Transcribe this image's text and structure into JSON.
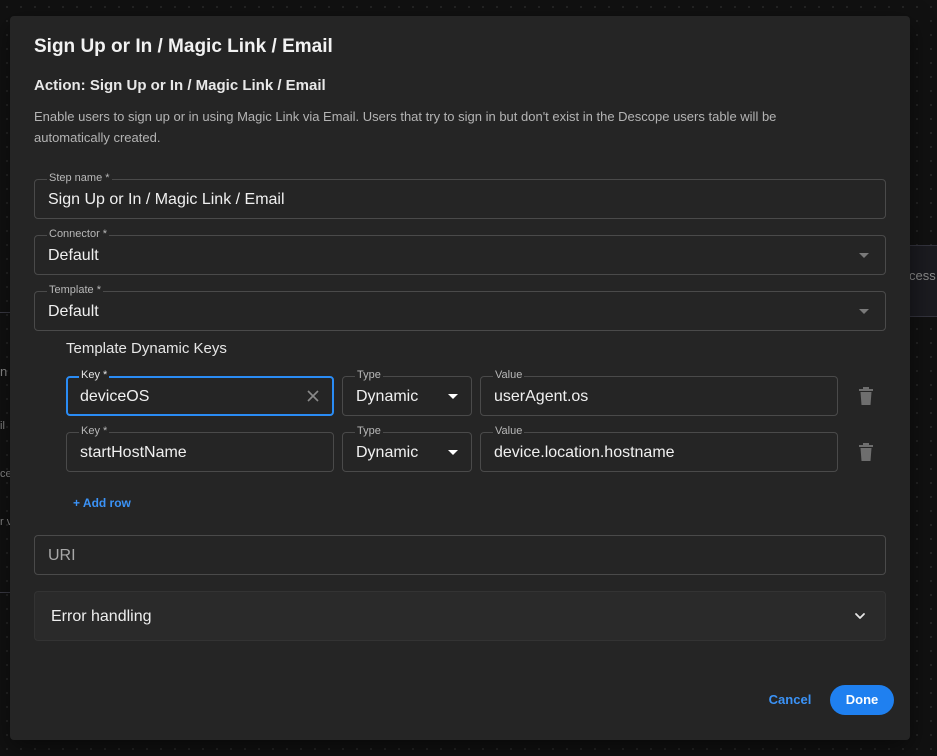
{
  "background": {
    "fragments": [
      "cess",
      "n l",
      "il",
      "ce",
      "r v"
    ]
  },
  "modal": {
    "title": "Sign Up or In / Magic Link / Email",
    "action_title": "Action: Sign Up or In / Magic Link / Email",
    "description": "Enable users to sign up or in using Magic Link via Email. Users that try to sign in but don't exist in the Descope users table will be automatically created."
  },
  "step_name": {
    "label": "Step name *",
    "value": "Sign Up or In / Magic Link / Email"
  },
  "connector": {
    "label": "Connector *",
    "value": "Default"
  },
  "template": {
    "label": "Template *",
    "value": "Default"
  },
  "dynamic_keys": {
    "title": "Template Dynamic Keys",
    "rows": [
      {
        "key_label": "Key *",
        "key": "deviceOS",
        "type_label": "Type",
        "type": "Dynamic",
        "value_label": "Value",
        "value": "userAgent.os"
      },
      {
        "key_label": "Key *",
        "key": "startHostName",
        "type_label": "Type",
        "type": "Dynamic",
        "value_label": "Value",
        "value": "device.location.hostname"
      }
    ],
    "add_row": "+ Add row"
  },
  "uri": {
    "placeholder": "URI"
  },
  "error_handling": {
    "label": "Error handling"
  },
  "actions": {
    "cancel": "Cancel",
    "done": "Done"
  },
  "colors": {
    "accent": "#2a8cf5",
    "modal_bg": "#252525",
    "page_bg": "#121212"
  },
  "icons": [
    "clear-icon",
    "trash-icon",
    "chevron-down-icon",
    "dropdown-arrow-icon"
  ]
}
